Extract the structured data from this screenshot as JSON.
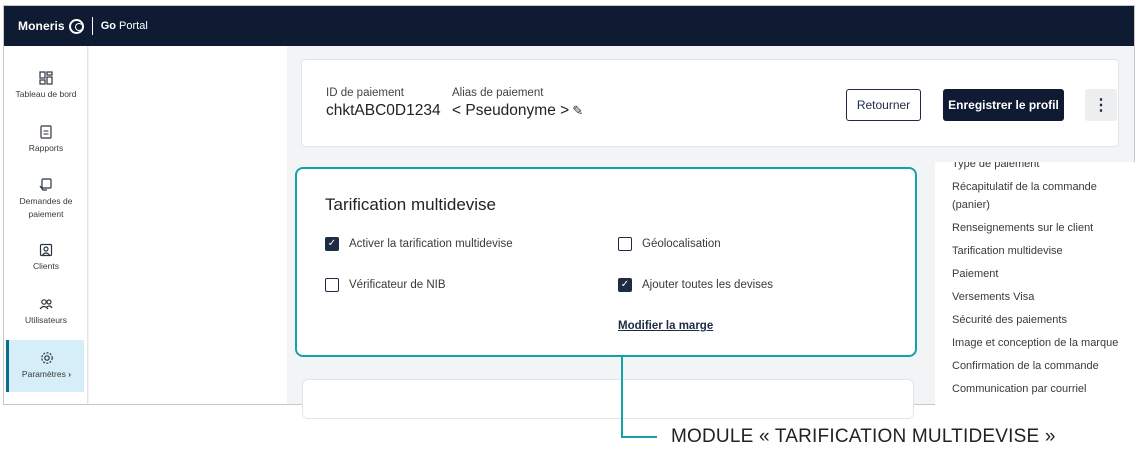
{
  "app": {
    "brand": "Moneris",
    "portal_bold": "Go",
    "portal_rest": " Portal"
  },
  "sidebar": {
    "items": [
      {
        "label": "Tableau de bord",
        "icon": "dashboard-icon"
      },
      {
        "label": "Rapports",
        "icon": "reports-icon"
      },
      {
        "label": "Demandes de paiement",
        "icon": "payment-request-icon"
      },
      {
        "label": "Clients",
        "icon": "clients-icon"
      },
      {
        "label": "Utilisateurs",
        "icon": "users-icon"
      },
      {
        "label": "Paramètres",
        "icon": "settings-icon",
        "active": true
      }
    ]
  },
  "header": {
    "payment_id_label": "ID de paiement",
    "payment_id_value": "chktABC0D1234",
    "alias_label": "Alias de paiement",
    "alias_value": "< Pseudonyme >",
    "return_button": "Retourner",
    "save_button": "Enregistrer le profil",
    "more_button": "⋮"
  },
  "module": {
    "title": "Tarification multidevise",
    "options": [
      {
        "label": "Activer la tarification multidevise",
        "checked": true
      },
      {
        "label": "Géolocalisation",
        "checked": false
      },
      {
        "label": "Vérificateur de NIB",
        "checked": false
      },
      {
        "label": "Ajouter toutes les devises",
        "checked": true
      }
    ],
    "link": "Modifier la marge"
  },
  "toc": {
    "items": [
      "Type de paiement",
      "Récapitulatif de la commande (panier)",
      "Renseignements sur le client",
      "Tarification multidevise",
      "Paiement",
      "Versements Visa",
      "Sécurité des paiements",
      "Image et conception de la marque",
      "Confirmation de la commande",
      "Communication par courriel"
    ]
  },
  "callout": {
    "text": "MODULE « TARIFICATION MULTIDEVISE »"
  },
  "colors": {
    "accent": "#12a3a8",
    "navy": "#0e1b33",
    "active_nav": "#d6eef7"
  }
}
